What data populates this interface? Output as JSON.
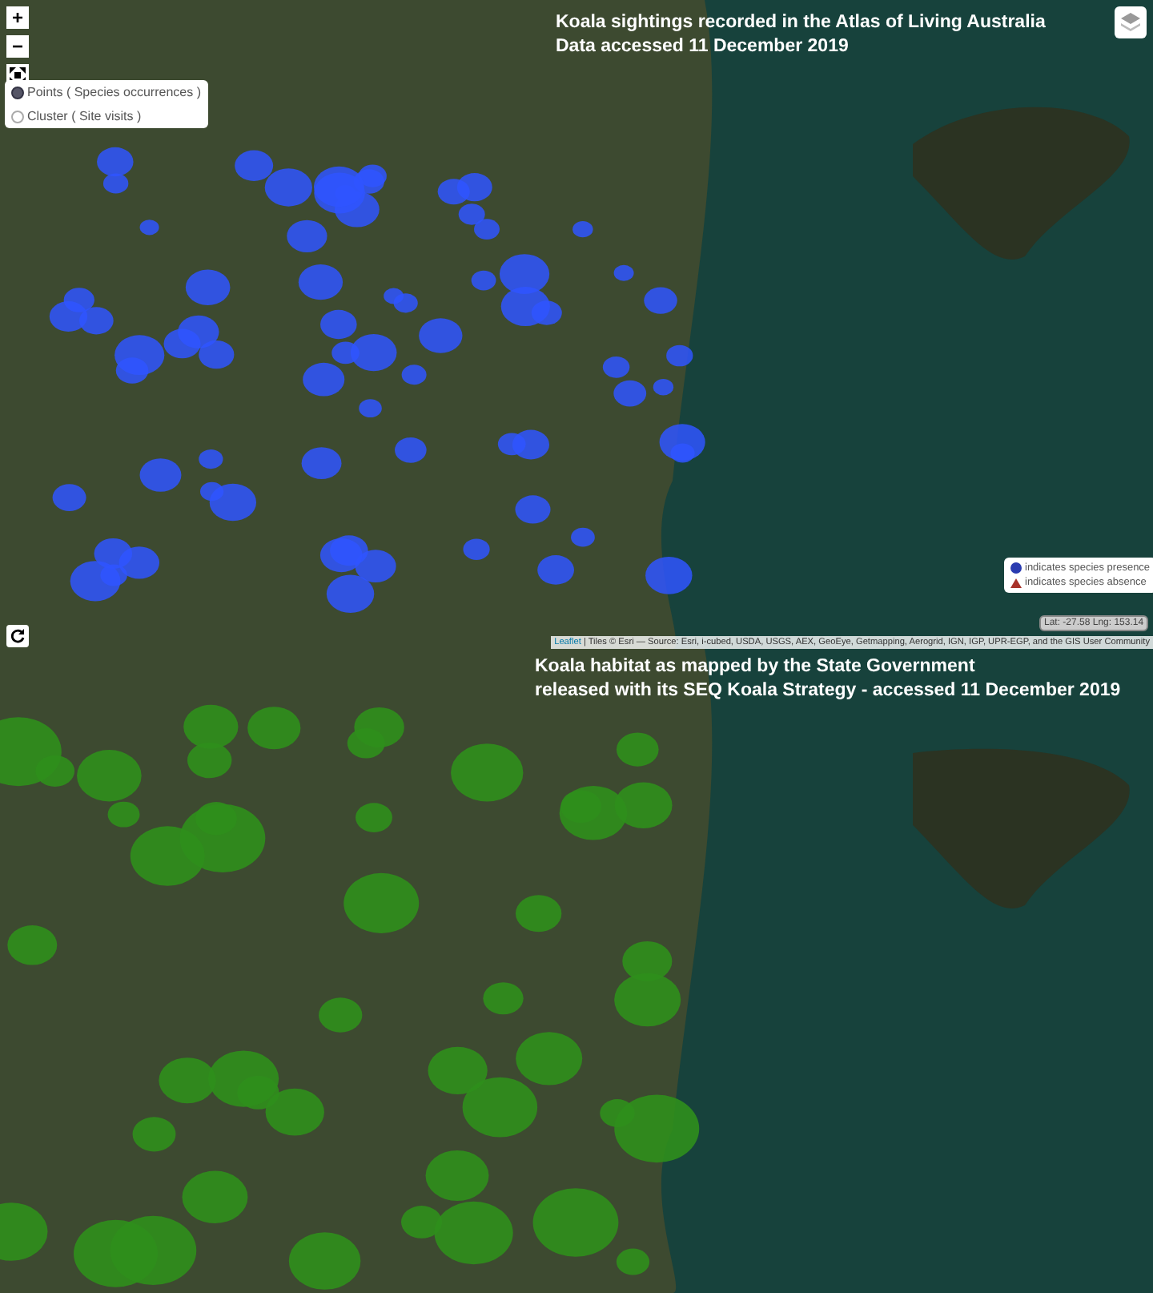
{
  "top_map": {
    "zoom_controls": [
      {
        "kind": "zoom-in",
        "label": "+"
      },
      {
        "kind": "zoom-out",
        "label": "−"
      },
      {
        "kind": "fullscreen"
      }
    ],
    "layer_options": [
      {
        "label": "Points ( Species occurrences )",
        "selected": true
      },
      {
        "label": "Cluster ( Site visits )",
        "selected": false
      }
    ],
    "title": [
      "Koala sightings recorded in the Atlas of Living Australia",
      "Data accessed 11 December 2019"
    ],
    "legend": [
      {
        "kind": "circle",
        "color": "#2a3bb0",
        "label": "indicates species presence"
      },
      {
        "kind": "triangle",
        "color": "#a8322a",
        "label": "indicates species absence"
      }
    ],
    "coordinates": "Lat: -27.58 Lng: 153.14",
    "attribution": {
      "link": "Leaflet",
      "text": "| Tiles © Esri — Source: Esri, i-cubed, USDA, USGS, AEX, GeoEye, Getmapping, Aerogrid, IGN, IGP, UPR-EGP, and the GIS User Community"
    }
  },
  "bottom_map": {
    "title": [
      "Koala habitat as mapped by the State Government",
      "released with its SEQ Koala Strategy - accessed 11 December 2019"
    ]
  }
}
